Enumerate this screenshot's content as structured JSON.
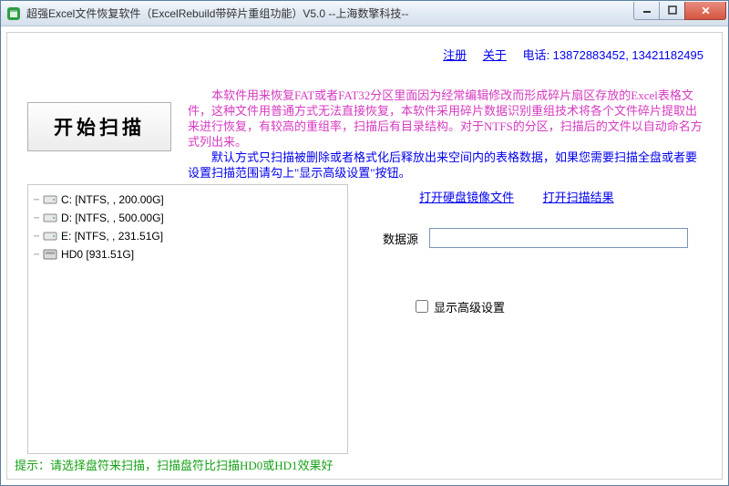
{
  "window": {
    "title": "超强Excel文件恢复软件（ExcelRebuild带碎片重组功能）V5.0  --上海数擎科技--"
  },
  "header_links": {
    "register": "注册",
    "about": "关于",
    "phone": "电话: 13872883452, 13421182495"
  },
  "scan_button": "开始扫描",
  "description": {
    "p1": "　　本软件用来恢复FAT或者FAT32分区里面因为经常编辑修改而形成碎片扇区存放的Excel表格文件，这种文件用普通方式无法直接恢复，本软件采用碎片数据识别重组技术将各个文件碎片提取出来进行恢复，有较高的重组率，扫描后有目录结构。对于NTFS的分区，扫描后的文件以自动命名方式列出来。",
    "p2": "　　默认方式只扫描被删除或者格式化后释放出来空间内的表格数据，如果您需要扫描全盘或者要设置扫描范围请勾上\"显示高级设置\"按钮。"
  },
  "drives": [
    {
      "label": "C:  [NTFS, , 200.00G]"
    },
    {
      "label": "D:  [NTFS, , 500.00G]"
    },
    {
      "label": "E:  [NTFS, , 231.51G]"
    },
    {
      "label": "HD0  [931.51G]"
    }
  ],
  "mid_links": {
    "open_image": "打开硬盘镜像文件",
    "open_result": "打开扫描结果"
  },
  "datasource": {
    "label": "数据源",
    "value": ""
  },
  "advanced": {
    "label": "显示高级设置",
    "checked": false
  },
  "hint": "提示：请选择盘符来扫描，扫描盘符比扫描HD0或HD1效果好"
}
